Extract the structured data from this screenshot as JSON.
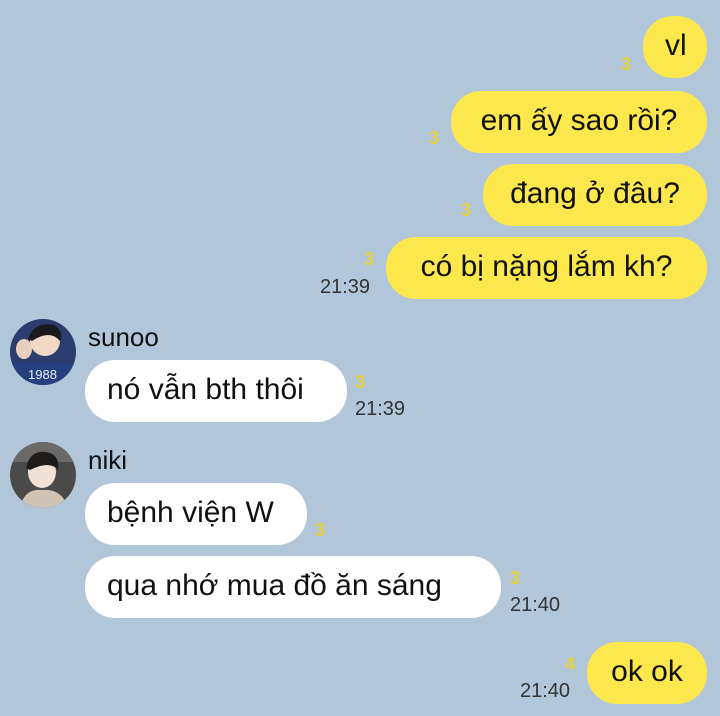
{
  "messages": {
    "m1": {
      "text": "vl",
      "count": "3"
    },
    "m2": {
      "text": "em ấy sao rồi?",
      "count": "3"
    },
    "m3": {
      "text": "đang ở đâu?",
      "count": "3"
    },
    "m4": {
      "text": "có bị nặng lắm kh?",
      "count": "3",
      "time": "21:39"
    },
    "m5": {
      "sender": "sunoo",
      "text": "nó vẫn bth thôi",
      "count": "3",
      "time": "21:39"
    },
    "m6": {
      "sender": "niki",
      "text": "bệnh viện W",
      "count": "3"
    },
    "m7": {
      "text": "qua nhớ mua đồ ăn sáng",
      "count": "3",
      "time": "21:40"
    },
    "m8": {
      "text": "ok ok",
      "count": "4",
      "time": "21:40"
    }
  },
  "avatars": {
    "sunoo": {
      "icon": "avatar-sunoo-icon",
      "jersey_text": "1988"
    },
    "niki": {
      "icon": "avatar-niki-icon"
    }
  },
  "colors": {
    "background": "#b1c7d9",
    "my_bubble": "#fce74c",
    "their_bubble": "#ffffff",
    "unread_count": "#e6d23a"
  }
}
